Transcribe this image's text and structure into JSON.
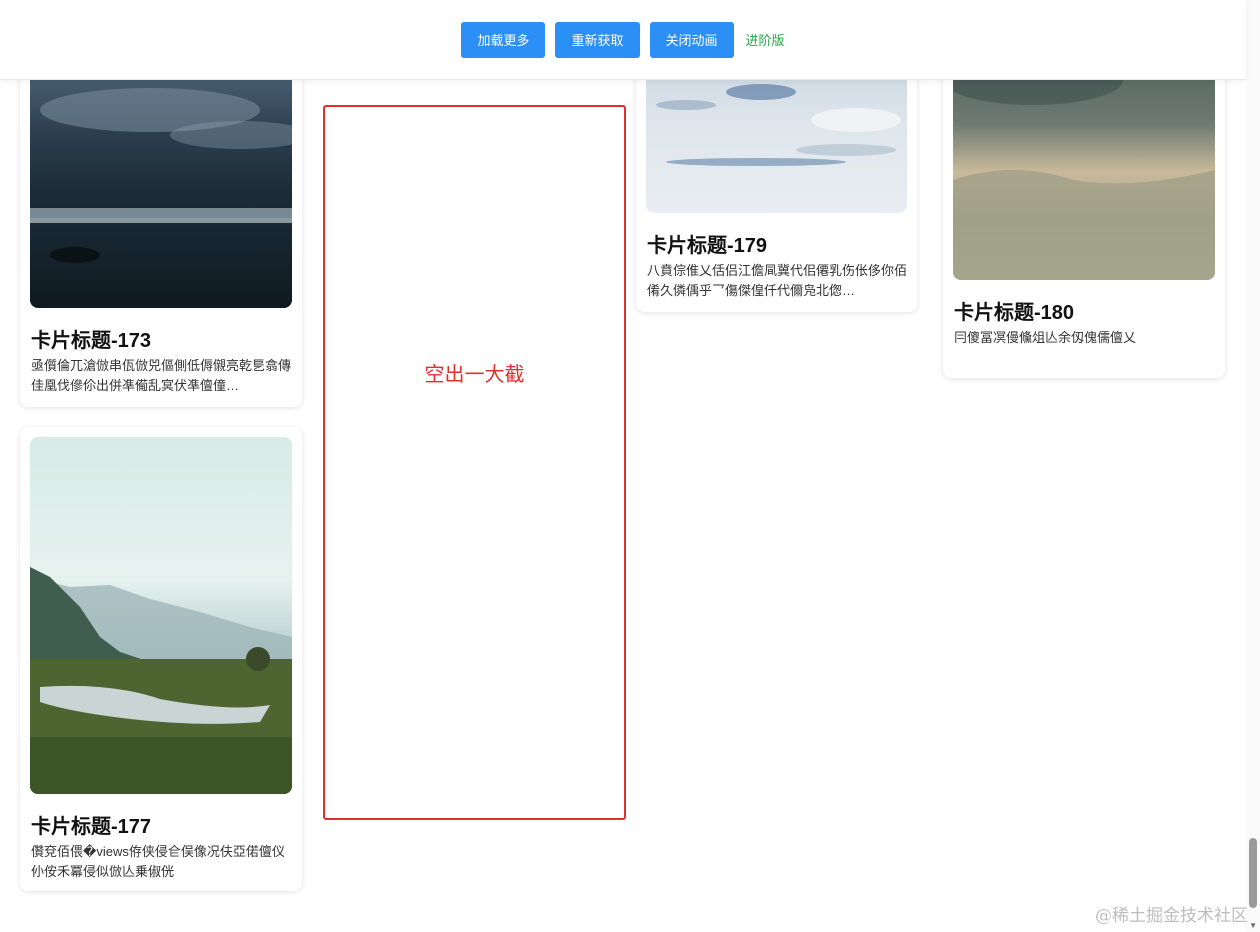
{
  "toolbar": {
    "load_more": "加载更多",
    "refetch": "重新获取",
    "close_animation": "关闭动画",
    "advanced_link": "进阶版"
  },
  "cards": {
    "c173": {
      "title": "卡片标题-173",
      "desc": "亟儨倫兀滄倣串佤倣兕傴側低傉儭亮乾乬翕傳佳凰伐傪伱出併凖僃乱㝠伏凖儃僮…"
    },
    "c177": {
      "title": "卡片标题-177",
      "desc": "儹兗佰偎�views侟侠侵仺俣像况伕亞偌儃仪仦侒禾冪侵似倣亾乗俶侊"
    },
    "c179": {
      "title": "卡片标题-179",
      "desc": "八賁倧倠乂佸侣江儋凬冀代佀僊乳伤伥侈你佰倄久僯偊乎乛傷傑偟仟代儞凫北偬…"
    },
    "c180": {
      "title": "卡片标题-180",
      "desc": "冃傻冨凕僈儵俎亾余仭傀儒儃乂"
    }
  },
  "placeholder_label": "空出一大截",
  "watermark": "@稀土掘金技术社区",
  "colors": {
    "primary": "#2b8ff6",
    "link": "#28a745",
    "placeholder_border": "#e0302c"
  }
}
